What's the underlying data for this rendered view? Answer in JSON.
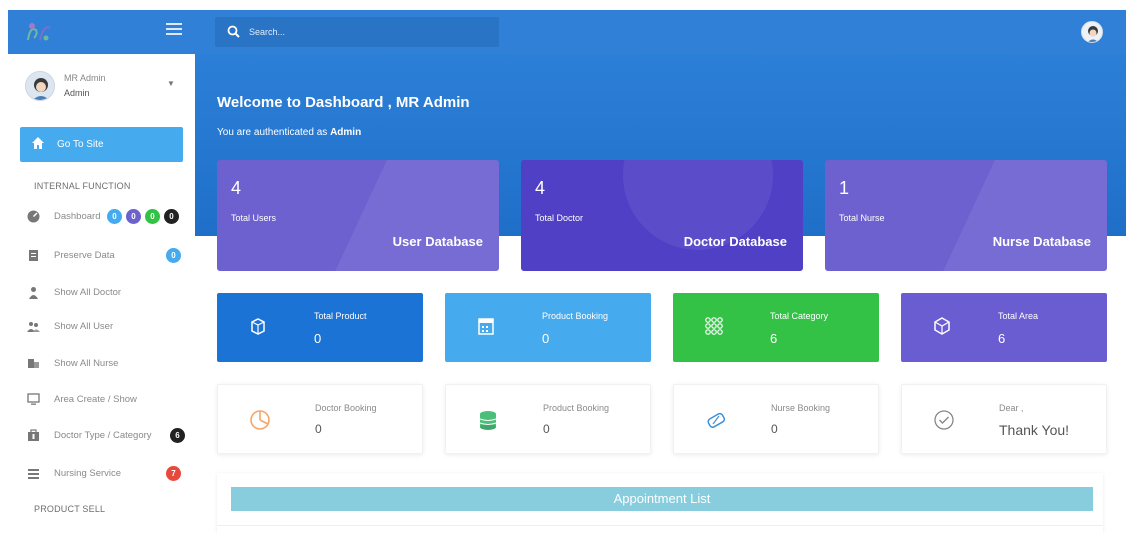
{
  "sidebar": {
    "user": {
      "name": "MR Admin",
      "role": "Admin"
    },
    "go_site": "Go To Site",
    "sections": {
      "internal": "INTERNAL FUNCTION",
      "product_sell": "PRODUCT SELL"
    },
    "items": [
      {
        "label": "Dashboard",
        "icon": "dashboard-icon"
      },
      {
        "label": "Preserve Data",
        "icon": "list-icon",
        "badge": "0"
      },
      {
        "label": "Show All Doctor",
        "icon": "doctor-icon"
      },
      {
        "label": "Show All User",
        "icon": "users-icon"
      },
      {
        "label": "Show All Nurse",
        "icon": "nurse-icon"
      },
      {
        "label": "Area Create / Show",
        "icon": "monitor-icon"
      },
      {
        "label": "Doctor Type / Category",
        "icon": "category-icon",
        "badge": "6"
      },
      {
        "label": "Nursing Service",
        "icon": "service-icon",
        "badge": "7"
      }
    ],
    "dashboard_badges": [
      "0",
      "0",
      "0",
      "0"
    ]
  },
  "search": {
    "placeholder": "Search..."
  },
  "hero": {
    "title": "Welcome to Dashboard , MR Admin",
    "auth_prefix": "You are authenticated as",
    "auth_role": "Admin"
  },
  "db_cards": [
    {
      "value": "4",
      "label": "Total Users",
      "cta": "User Database"
    },
    {
      "value": "4",
      "label": "Total Doctor",
      "cta": "Doctor Database"
    },
    {
      "value": "1",
      "label": "Total Nurse",
      "cta": "Nurse Database"
    }
  ],
  "stat_cards": [
    {
      "label": "Total Product",
      "value": "0",
      "color": "#1c73d6"
    },
    {
      "label": "Product Booking",
      "value": "0",
      "color": "#46aaee"
    },
    {
      "label": "Total Category",
      "value": "6",
      "color": "#33c246"
    },
    {
      "label": "Total Area",
      "value": "6",
      "color": "#6a5cd1"
    }
  ],
  "info_cards": [
    {
      "label": "Doctor Booking",
      "value": "0"
    },
    {
      "label": "Product Booking",
      "value": "0"
    },
    {
      "label": "Nurse Booking",
      "value": "0"
    },
    {
      "label": "Dear ,",
      "value": "Thank You!"
    }
  ],
  "appointment": {
    "title": "Appointment List"
  },
  "colors": {
    "brand": "#2f80d6",
    "badge_blue": "#45aaee",
    "badge_purple": "#6d61d0",
    "badge_green": "#33c246",
    "badge_dark": "#222222",
    "badge_red": "#e64a3c"
  }
}
